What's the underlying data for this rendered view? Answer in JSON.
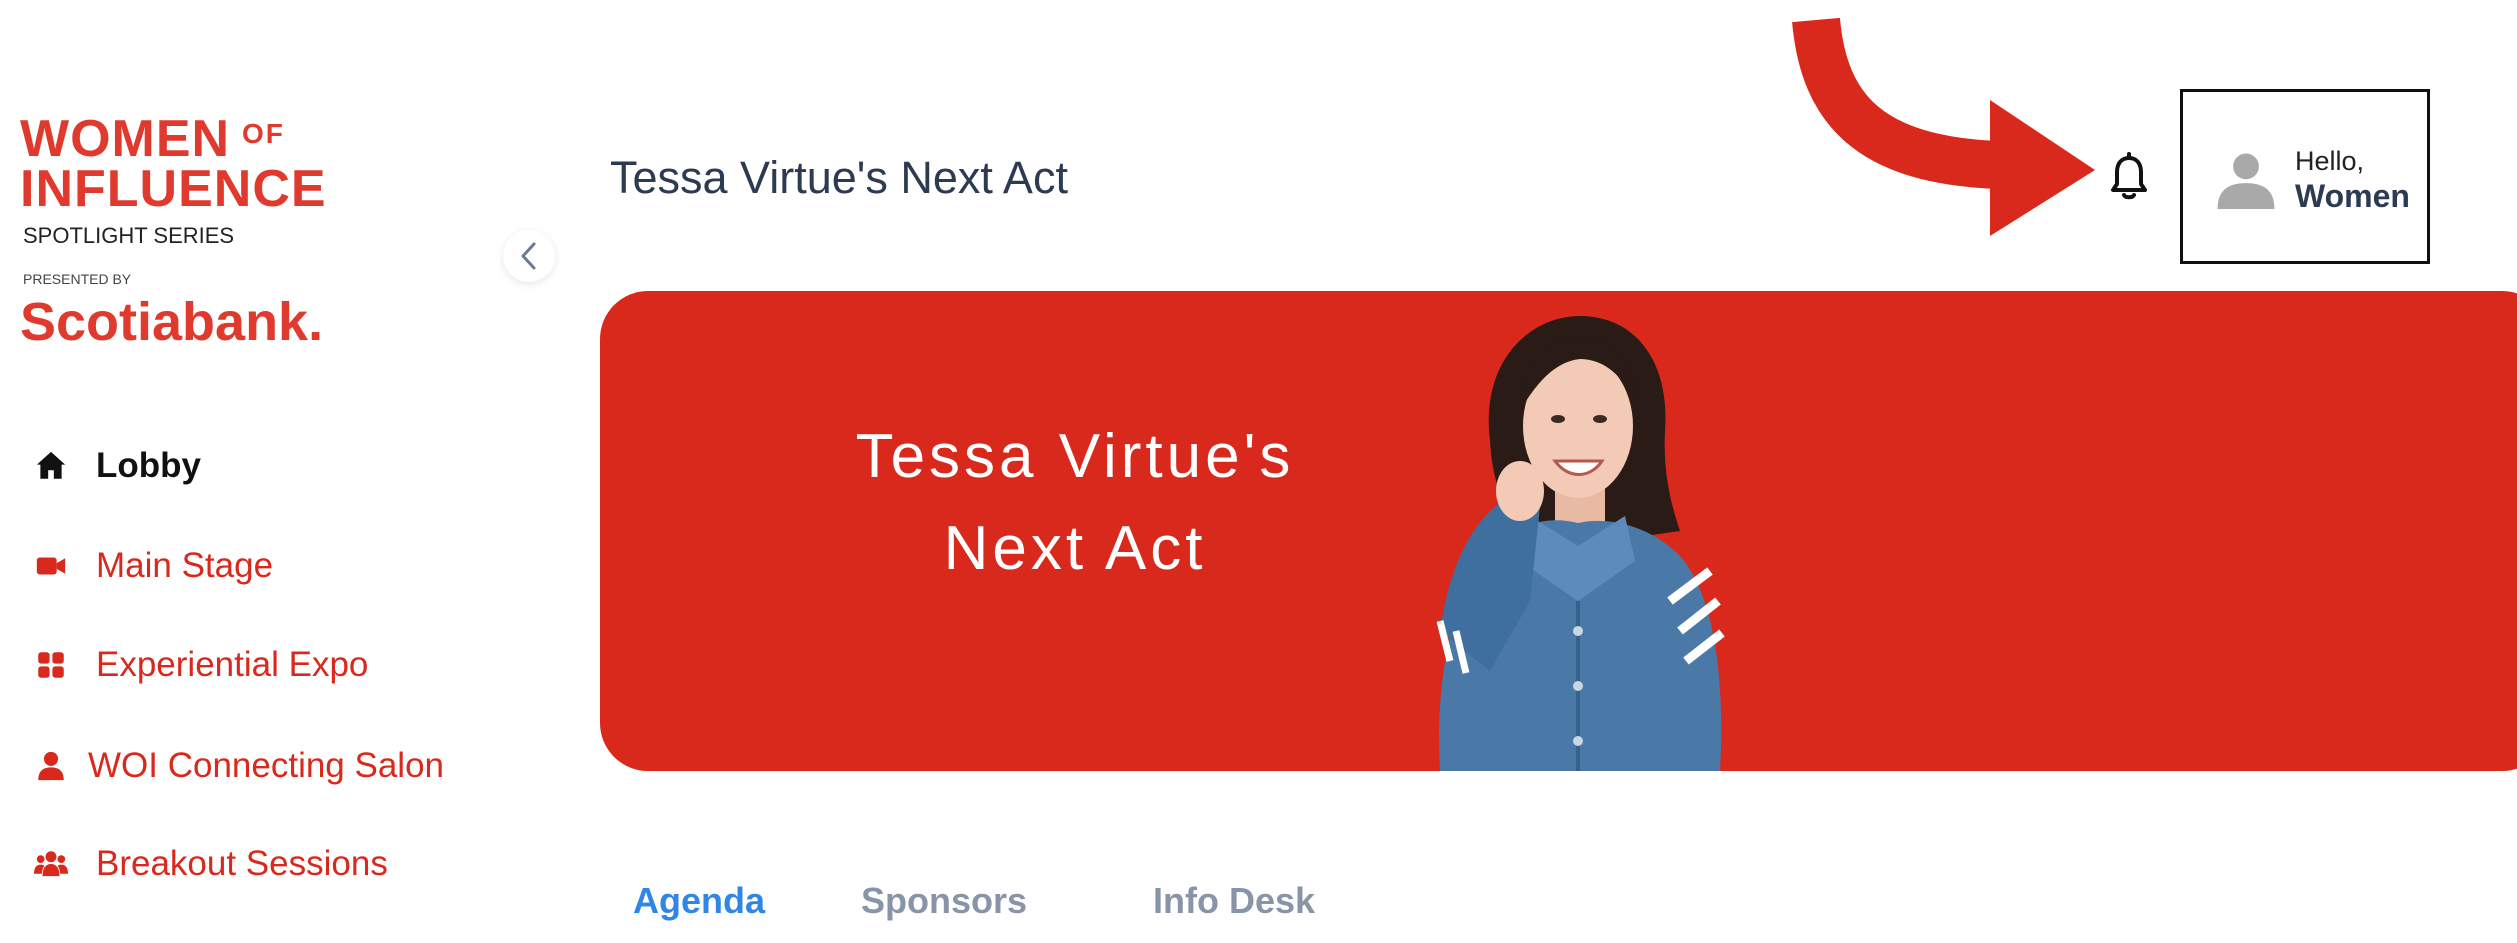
{
  "brand": {
    "line1": "WOMEN",
    "of": "OF",
    "line2": "INFLUENCE",
    "series": "SPOTLIGHT SERIES",
    "presented_by": "PRESENTED BY",
    "sponsor": "Scotiabank."
  },
  "sidebar": {
    "items": [
      {
        "label": "Lobby",
        "icon": "home-icon",
        "active": true
      },
      {
        "label": "Main Stage",
        "icon": "video-camera-icon",
        "active": false
      },
      {
        "label": "Experiential Expo",
        "icon": "grid-icon",
        "active": false
      },
      {
        "label": "WOI Connecting Salon",
        "icon": "user-icon",
        "active": false
      },
      {
        "label": "Breakout Sessions",
        "icon": "users-group-icon",
        "active": false
      }
    ]
  },
  "header": {
    "title": "Tessa Virtue's Next Act",
    "greeting": "Hello,",
    "user_name": "Women"
  },
  "banner": {
    "line1": "Tessa Virtue's",
    "line2": "Next Act"
  },
  "tabs": [
    {
      "label": "Agenda",
      "active": true
    },
    {
      "label": "Sponsors",
      "active": false
    },
    {
      "label": "Info Desk",
      "active": false
    }
  ],
  "colors": {
    "brand_red": "#d9291c",
    "title_navy": "#2d3b52",
    "tab_active": "#2f86e6",
    "tab_inactive": "#8895a8"
  }
}
